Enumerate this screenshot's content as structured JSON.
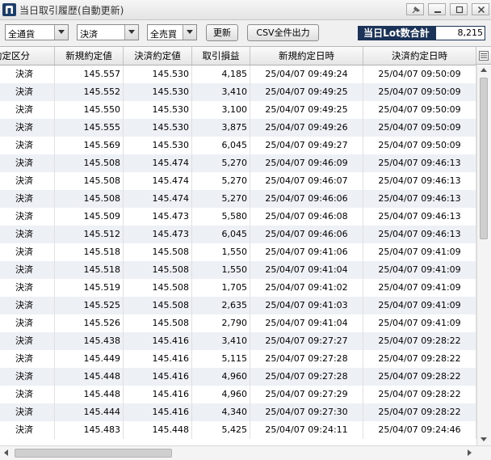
{
  "window": {
    "title": "当日取引履歴(自動更新)"
  },
  "toolbar": {
    "currency_filter": "全通貨",
    "settle_filter": "決済",
    "side_filter": "全売買",
    "refresh_label": "更新",
    "csv_label": "CSV全件出力",
    "lot_label": "当日Lot数合計",
    "lot_value": "8,215"
  },
  "table": {
    "headers": [
      "約定区分",
      "新規約定値",
      "決済約定値",
      "取引損益",
      "新規約定日時",
      "決済約定日時"
    ],
    "rows": [
      [
        "決済",
        "145.557",
        "145.530",
        "4,185",
        "25/04/07 09:49:24",
        "25/04/07 09:50:09"
      ],
      [
        "決済",
        "145.552",
        "145.530",
        "3,410",
        "25/04/07 09:49:25",
        "25/04/07 09:50:09"
      ],
      [
        "決済",
        "145.550",
        "145.530",
        "3,100",
        "25/04/07 09:49:25",
        "25/04/07 09:50:09"
      ],
      [
        "決済",
        "145.555",
        "145.530",
        "3,875",
        "25/04/07 09:49:26",
        "25/04/07 09:50:09"
      ],
      [
        "決済",
        "145.569",
        "145.530",
        "6,045",
        "25/04/07 09:49:27",
        "25/04/07 09:50:09"
      ],
      [
        "決済",
        "145.508",
        "145.474",
        "5,270",
        "25/04/07 09:46:09",
        "25/04/07 09:46:13"
      ],
      [
        "決済",
        "145.508",
        "145.474",
        "5,270",
        "25/04/07 09:46:07",
        "25/04/07 09:46:13"
      ],
      [
        "決済",
        "145.508",
        "145.474",
        "5,270",
        "25/04/07 09:46:06",
        "25/04/07 09:46:13"
      ],
      [
        "決済",
        "145.509",
        "145.473",
        "5,580",
        "25/04/07 09:46:08",
        "25/04/07 09:46:13"
      ],
      [
        "決済",
        "145.512",
        "145.473",
        "6,045",
        "25/04/07 09:46:06",
        "25/04/07 09:46:13"
      ],
      [
        "決済",
        "145.518",
        "145.508",
        "1,550",
        "25/04/07 09:41:06",
        "25/04/07 09:41:09"
      ],
      [
        "決済",
        "145.518",
        "145.508",
        "1,550",
        "25/04/07 09:41:04",
        "25/04/07 09:41:09"
      ],
      [
        "決済",
        "145.519",
        "145.508",
        "1,705",
        "25/04/07 09:41:02",
        "25/04/07 09:41:09"
      ],
      [
        "決済",
        "145.525",
        "145.508",
        "2,635",
        "25/04/07 09:41:03",
        "25/04/07 09:41:09"
      ],
      [
        "決済",
        "145.526",
        "145.508",
        "2,790",
        "25/04/07 09:41:04",
        "25/04/07 09:41:09"
      ],
      [
        "決済",
        "145.438",
        "145.416",
        "3,410",
        "25/04/07 09:27:27",
        "25/04/07 09:28:22"
      ],
      [
        "決済",
        "145.449",
        "145.416",
        "5,115",
        "25/04/07 09:27:28",
        "25/04/07 09:28:22"
      ],
      [
        "決済",
        "145.448",
        "145.416",
        "4,960",
        "25/04/07 09:27:28",
        "25/04/07 09:28:22"
      ],
      [
        "決済",
        "145.448",
        "145.416",
        "4,960",
        "25/04/07 09:27:29",
        "25/04/07 09:28:22"
      ],
      [
        "決済",
        "145.444",
        "145.416",
        "4,340",
        "25/04/07 09:27:30",
        "25/04/07 09:28:22"
      ],
      [
        "決済",
        "145.483",
        "145.448",
        "5,425",
        "25/04/07 09:24:11",
        "25/04/07 09:24:46"
      ]
    ]
  }
}
